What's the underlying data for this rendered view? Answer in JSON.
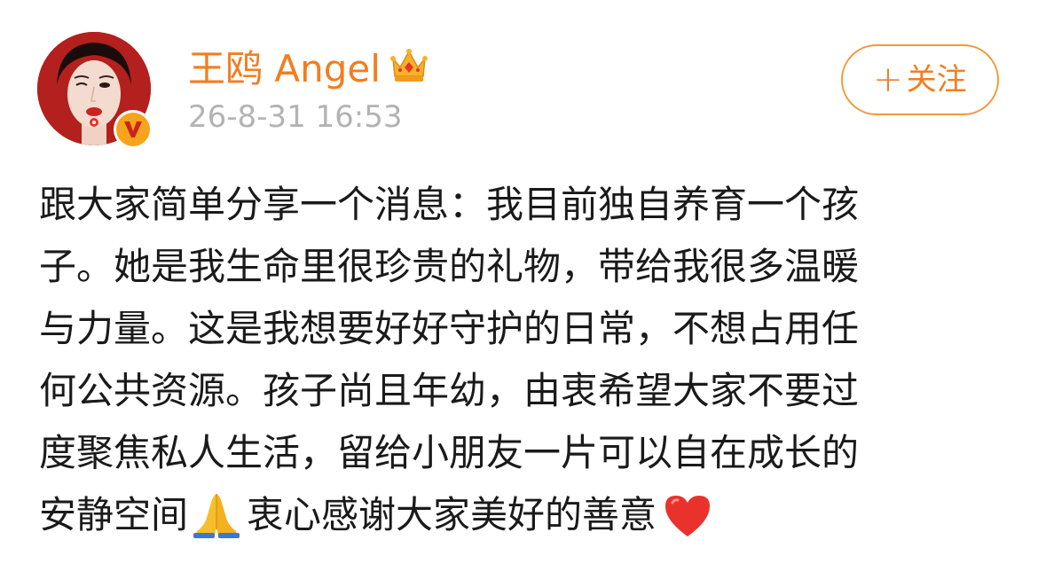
{
  "post": {
    "author": {
      "name": "王鸥 Angel",
      "avatar_icon": "avatar",
      "badge_icon": "verified-v-icon",
      "crown_icon": "crown-icon"
    },
    "timestamp": "26-8-31 16:53",
    "follow_button": {
      "plus": "+",
      "label": "关注"
    },
    "content": {
      "lines": [
        "跟大家简单分享一个消息：我目前独自养育一个孩",
        "子。她是我生命里很珍贵的礼物，带给我很多温暖",
        "与力量。这是我想要好好守护的日常，不想占用任",
        "何公共资源。孩子尚且年幼，由衷希望大家不要过",
        "度聚焦私人生活，留给小朋友一片可以自在成长的"
      ],
      "last_line_part1": "安静空间",
      "pray_emoji": "folded-hands-icon",
      "last_line_part2": "衷心感谢大家美好的善意",
      "heart_emoji": "red-heart-icon"
    }
  },
  "colors": {
    "accent": "#f37d1f",
    "timestamp": "#b3b3b3",
    "text": "#1a1a1a",
    "badge": "#f5a41b",
    "heart": "#e8322b"
  }
}
